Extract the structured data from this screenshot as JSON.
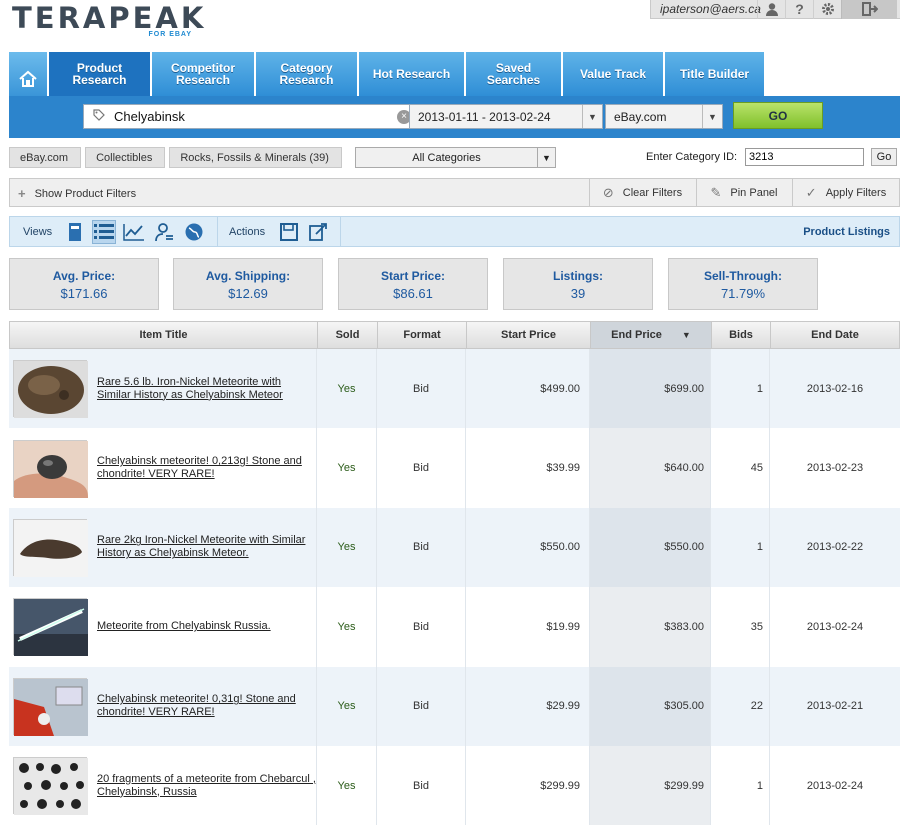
{
  "brand": {
    "name": "TERAPEAK",
    "tagline": "FOR EBAY"
  },
  "user": {
    "email": "ipaterson@aers.ca",
    "icons": [
      "user-icon",
      "help-icon",
      "gear-icon",
      "logout-icon"
    ],
    "help_glyph": "?"
  },
  "tabs": [
    {
      "label": "",
      "icon": "home-icon"
    },
    {
      "label": "Product\nResearch",
      "active": true
    },
    {
      "label": "Competitor\nResearch"
    },
    {
      "label": "Category\nResearch"
    },
    {
      "label": "Hot Research"
    },
    {
      "label": "Saved\nSearches"
    },
    {
      "label": "Value Track"
    },
    {
      "label": "Title Builder"
    }
  ],
  "search": {
    "query": "Chelyabinsk",
    "date_range": "2013-01-11 - 2013-02-24",
    "site": "eBay.com",
    "go_label": "GO"
  },
  "breadcrumb": [
    "eBay.com",
    "Collectibles",
    "Rocks, Fossils & Minerals (39)"
  ],
  "category_select": "All Categories",
  "category_id": {
    "label": "Enter Category ID:",
    "value": "3213",
    "go_label": "Go"
  },
  "filters": {
    "show_label": "Show Product Filters",
    "clear_label": "Clear Filters",
    "pin_label": "Pin Panel",
    "apply_label": "Apply Filters"
  },
  "views": {
    "label": "Views",
    "actions_label": "Actions",
    "mode_label": "Product Listings",
    "view_icons": [
      "gallery-view-icon",
      "list-view-icon",
      "chart-view-icon",
      "seller-view-icon",
      "globe-view-icon"
    ],
    "action_icons": [
      "save-icon",
      "export-icon"
    ]
  },
  "stats": [
    {
      "label": "Avg. Price:",
      "value": "$171.66"
    },
    {
      "label": "Avg. Shipping:",
      "value": "$12.69"
    },
    {
      "label": "Start Price:",
      "value": "$86.61"
    },
    {
      "label": "Listings:",
      "value": "39"
    },
    {
      "label": "Sell-Through:",
      "value": "71.79%"
    }
  ],
  "table": {
    "columns": [
      "Item Title",
      "Sold",
      "Format",
      "Start Price",
      "End Price",
      "Bids",
      "End Date"
    ],
    "sorted_column": "End Price",
    "rows": [
      {
        "title": "Rare 5.6 lb. Iron-Nickel Meteorite with Similar History as Chelyabinsk Meteor",
        "sold": "Yes",
        "format": "Bid",
        "start": "$499.00",
        "end": "$699.00",
        "bids": "1",
        "date": "2013-02-16"
      },
      {
        "title": "Chelyabinsk meteorite! 0,213g! Stone and chondrite! VERY RARE!",
        "sold": "Yes",
        "format": "Bid",
        "start": "$39.99",
        "end": "$640.00",
        "bids": "45",
        "date": "2013-02-23"
      },
      {
        "title": "Rare 2kg Iron-Nickel Meteorite with Similar History as Chelyabinsk Meteor.",
        "sold": "Yes",
        "format": "Bid",
        "start": "$550.00",
        "end": "$550.00",
        "bids": "1",
        "date": "2013-02-22"
      },
      {
        "title": "Meteorite from Chelyabinsk Russia.",
        "sold": "Yes",
        "format": "Bid",
        "start": "$19.99",
        "end": "$383.00",
        "bids": "35",
        "date": "2013-02-24"
      },
      {
        "title": "Chelyabinsk meteorite! 0,31g! Stone and chondrite! VERY RARE!",
        "sold": "Yes",
        "format": "Bid",
        "start": "$29.99",
        "end": "$305.00",
        "bids": "22",
        "date": "2013-02-21"
      },
      {
        "title": "20 fragments of a meteorite from Chebarcul , Chelyabinsk, Russia",
        "sold": "Yes",
        "format": "Bid",
        "start": "$299.99",
        "end": "$299.99",
        "bids": "1",
        "date": "2013-02-24"
      }
    ]
  },
  "colors": {
    "accent": "#2c84cc",
    "go": "#80c02b",
    "stat_text": "#1f5aa0"
  }
}
